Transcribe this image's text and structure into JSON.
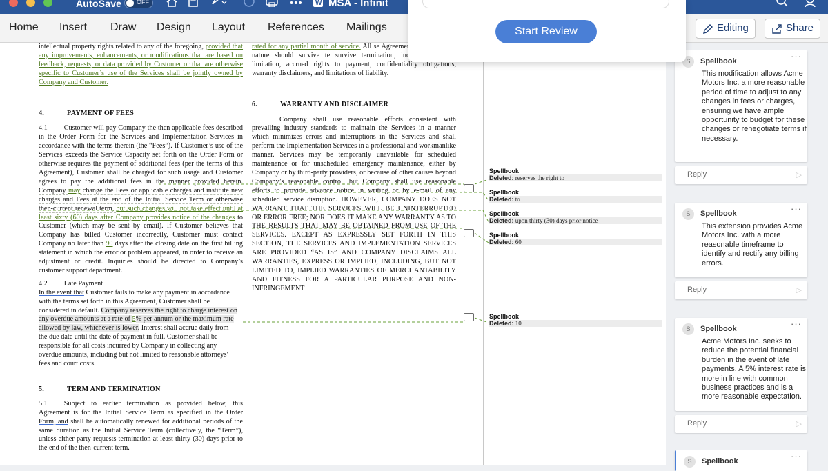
{
  "window": {
    "autosave_label": "AutoSave",
    "autosave_state": "OFF",
    "doc_title": "MSA - Infinit",
    "traffic_lights": [
      "#ed6a5e",
      "#f5bf4f",
      "#61c554"
    ]
  },
  "ribbon": {
    "tabs": [
      "Home",
      "Insert",
      "Draw",
      "Design",
      "Layout",
      "References",
      "Mailings"
    ],
    "editing_label": "Editing",
    "share_label": "Share"
  },
  "popup": {
    "start_review_label": "Start Review"
  },
  "document": {
    "left": {
      "top_para": {
        "t1": "intellectual property rights related to any of the foregoing, ",
        "ins": "provided that any improvements, enhancements, or modifications that are based on feedback, requests, or data provided by Customer or that are otherwise specific to Customer’s use of the Services shall be jointly owned by Company and Customer."
      },
      "s4_num": "4.",
      "s4_title": "PAYMENT OF FEES",
      "p41": {
        "num": "4.1",
        "t1": "Customer will pay Company the then applicable fees described in the Order Form for the Services and Implementation Services in accordance with the terms therein (the “Fees”). If Customer’s use of the Services exceeds the Service Capacity set forth on the Order Form or otherwise requires the payment of additional fees (per the terms of this Agreement), Customer shall be charged for such usage and Customer agrees to pay the additional fees in the manner provided herein. ",
        "t2": "Company ",
        "ins1": "may",
        "t3": " change the Fees or applicable charges and institute new charges and Fees at the end of the Initial Service Term or otherwise then-current renewal term, ",
        "ins2": "but such changes will not take effect until at least sixty (60) days after Company provides notice of the changes",
        "t4": " to Customer (which may be sent by email). If Customer believes that Company has billed Customer incorrectly, Customer must contact Company no later than ",
        "ins3": "90",
        "t5": " days after the closing date on the first billing statement in which the error or problem appeared, in order to receive an adjustment or credit. Inquiries should be directed to Company’s customer support department."
      },
      "p42": {
        "num": "4.2",
        "title": "Late Payment",
        "t1": "In the event that",
        "t2": " Customer fails to make any payment in accordance with the terms set forth in this Agreement, Customer shall be considered in default. ",
        "t3": "Company reserves the right to charge interest on any overdue amounts at a rate of ",
        "ins": "5",
        "t4": "% per annum or the maximum rate allowed by law, whichever is lower.",
        "t5": " Interest shall accrue daily from the due date until the date of payment in full. Customer shall be responsible for all costs incurred by Company in collecting any overdue amounts, including but not limited to reasonable attorneys' fees and court costs."
      },
      "s5_num": "5.",
      "s5_title": "TERM AND TERMINATION",
      "p51": {
        "num": "5.1",
        "t1": "Subject to earlier termination as provided below, this Agreement is for the Initial Service Term as specified in the Order ",
        "t2": "Form, and",
        "t3": " shall be automatically renewed for additional periods of the same duration as the Initial Service Term (collectively, the “Term”), unless either party requests termination at least thirty (30) days prior to the end of the then-current term."
      }
    },
    "right": {
      "top_para": {
        "ins": "rated for any partial month of service.",
        "t1": " All se Agreement which by their nature should survive te survive termination, including, without limitation, accrued rights to payment, confidentiality obligations, warranty disclaimers, and limitations of liability."
      },
      "s6_num": "6.",
      "s6_title": "WARRANTY AND DISCLAIMER",
      "p6": "Company shall use reasonable efforts consistent with prevailing industry standards to maintain the Services in a manner which minimizes errors and interruptions in the Services and shall perform the Implementation Services in a professional and workmanlike manner. Services may be temporarily unavailable for scheduled maintenance or for unscheduled emergency maintenance, either by Company or by third-party providers, or because of other causes beyond Company’s reasonable control, but Company shall use reasonable efforts to provide advance notice in writing or by e-mail of any scheduled service disruption. HOWEVER, COMPANY DOES NOT WARRANT THAT THE SERVICES WILL BE UNINTERRUPTED OR ERROR FREE; NOR DOES IT MAKE ANY WARRANTY AS TO THE RESULTS THAT MAY BE OBTAINED FROM USE OF THE SERVICES. EXCEPT AS EXPRESSLY SET FORTH IN THIS SECTION, THE SERVICES AND IMPLEMENTATION SERVICES ARE PROVIDED “AS IS” AND COMPANY DISCLAIMS ALL WARRANTIES, EXPRESS OR IMPLIED, INCLUDING, BUT NOT LIMITED TO, IMPLIED WARRANTIES OF MERCHANTABILITY AND FITNESS FOR A PARTICULAR PURPOSE AND NON-INFRINGEMENT"
    }
  },
  "markup": [
    {
      "author": "Spellbook",
      "label": "Deleted:",
      "text": "reserves the right to"
    },
    {
      "author": "Spellbook",
      "label": "Deleted:",
      "text": "to"
    },
    {
      "author": "Spellbook",
      "label": "Deleted:",
      "text": "upon thirty (30) days prior notice"
    },
    {
      "author": "Spellbook",
      "label": "Deleted:",
      "text": "60"
    },
    {
      "author": "Spellbook",
      "label": "Deleted:",
      "text": "10"
    }
  ],
  "comments": [
    {
      "avatar": "S",
      "author": "Spellbook",
      "more": "···",
      "body": "This modification allows Acme Motors Inc. a more reasonable period of time to adjust to any changes in fees or charges, ensuring we have ample opportunity to budget for these changes or renegotiate terms if necessary.",
      "reply": "Reply"
    },
    {
      "avatar": "S",
      "author": "Spellbook",
      "more": "···",
      "body": "This extension provides Acme Motors Inc. with a more reasonable timeframe to identify and rectify any billing errors.",
      "reply": "Reply"
    },
    {
      "avatar": "S",
      "author": "Spellbook",
      "more": "···",
      "body": "Acme Motors Inc. seeks to reduce the potential financial burden in the event of late payments. A 5% interest rate is more in line with common business practices and is a more reasonable expectation.",
      "reply": "Reply"
    },
    {
      "avatar": "S",
      "author": "Spellbook",
      "more": "···"
    }
  ]
}
